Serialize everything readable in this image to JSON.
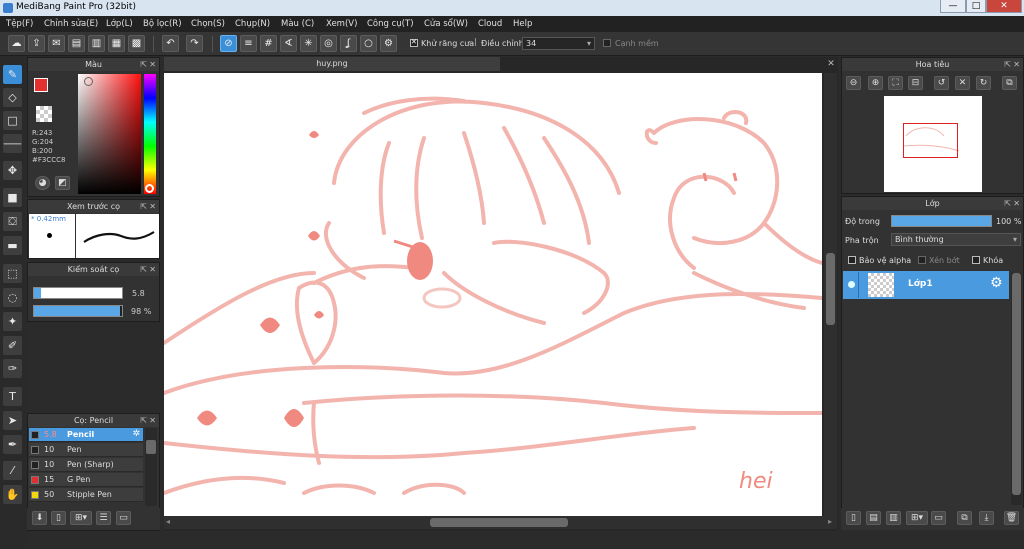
{
  "window": {
    "title": "MediBang Paint Pro (32bit)",
    "min": "—",
    "max": "□",
    "close": "✕"
  },
  "menu": [
    "Tệp(F)",
    "Chỉnh sửa(E)",
    "Lớp(L)",
    "Bộ lọc(R)",
    "Chọn(S)",
    "Chụp(N)",
    "Màu (C)",
    "Xem(V)",
    "Công cụ(T)",
    "Cửa sổ(W)",
    "Cloud",
    "Help"
  ],
  "toolbar": {
    "antialias_label": "Khử răng cưa",
    "adjust_label": "Điều chỉnh",
    "adjust_value": "34",
    "edge_label": "Cạnh mềm"
  },
  "color_panel": {
    "title": "Màu",
    "r": "R:243",
    "g": "G:204",
    "b": "B:200",
    "hex": "#F3CCC8",
    "fg": "#F3CCC8"
  },
  "brush_preview": {
    "title": "Xem trước cọ",
    "size": "0.42mm"
  },
  "brush_control": {
    "title": "Kiểm soát cọ",
    "size_value": "5.8",
    "opacity_value": "98 %",
    "opacity": 0.98,
    "size_fill": 0.08
  },
  "brush_list": {
    "title": "Cọ: Pencil",
    "items": [
      {
        "size": "5.8",
        "name": "Pencil",
        "color": "#222222",
        "selected": true
      },
      {
        "size": "10",
        "name": "Pen",
        "color": "#222222",
        "selected": false
      },
      {
        "size": "10",
        "name": "Pen (Sharp)",
        "color": "#222222",
        "selected": false
      },
      {
        "size": "15",
        "name": "G Pen",
        "color": "#e03030",
        "selected": false
      },
      {
        "size": "50",
        "name": "Stipple Pen",
        "color": "#f2d90a",
        "selected": false
      }
    ]
  },
  "canvas": {
    "tab": "huy.png",
    "signature": "hei"
  },
  "navigator": {
    "title": "Hoa tiêu"
  },
  "layers": {
    "title": "Lớp",
    "opacity_label": "Độ trong",
    "opacity_value": "100 %",
    "opacity": 1.0,
    "blend_label": "Pha trộn",
    "blend_value": "Bình thường",
    "protect_alpha": "Bảo vệ alpha",
    "clipping": "Xén bớt",
    "lock": "Khóa",
    "items": [
      {
        "name": "Lớp1",
        "selected": true
      }
    ]
  }
}
